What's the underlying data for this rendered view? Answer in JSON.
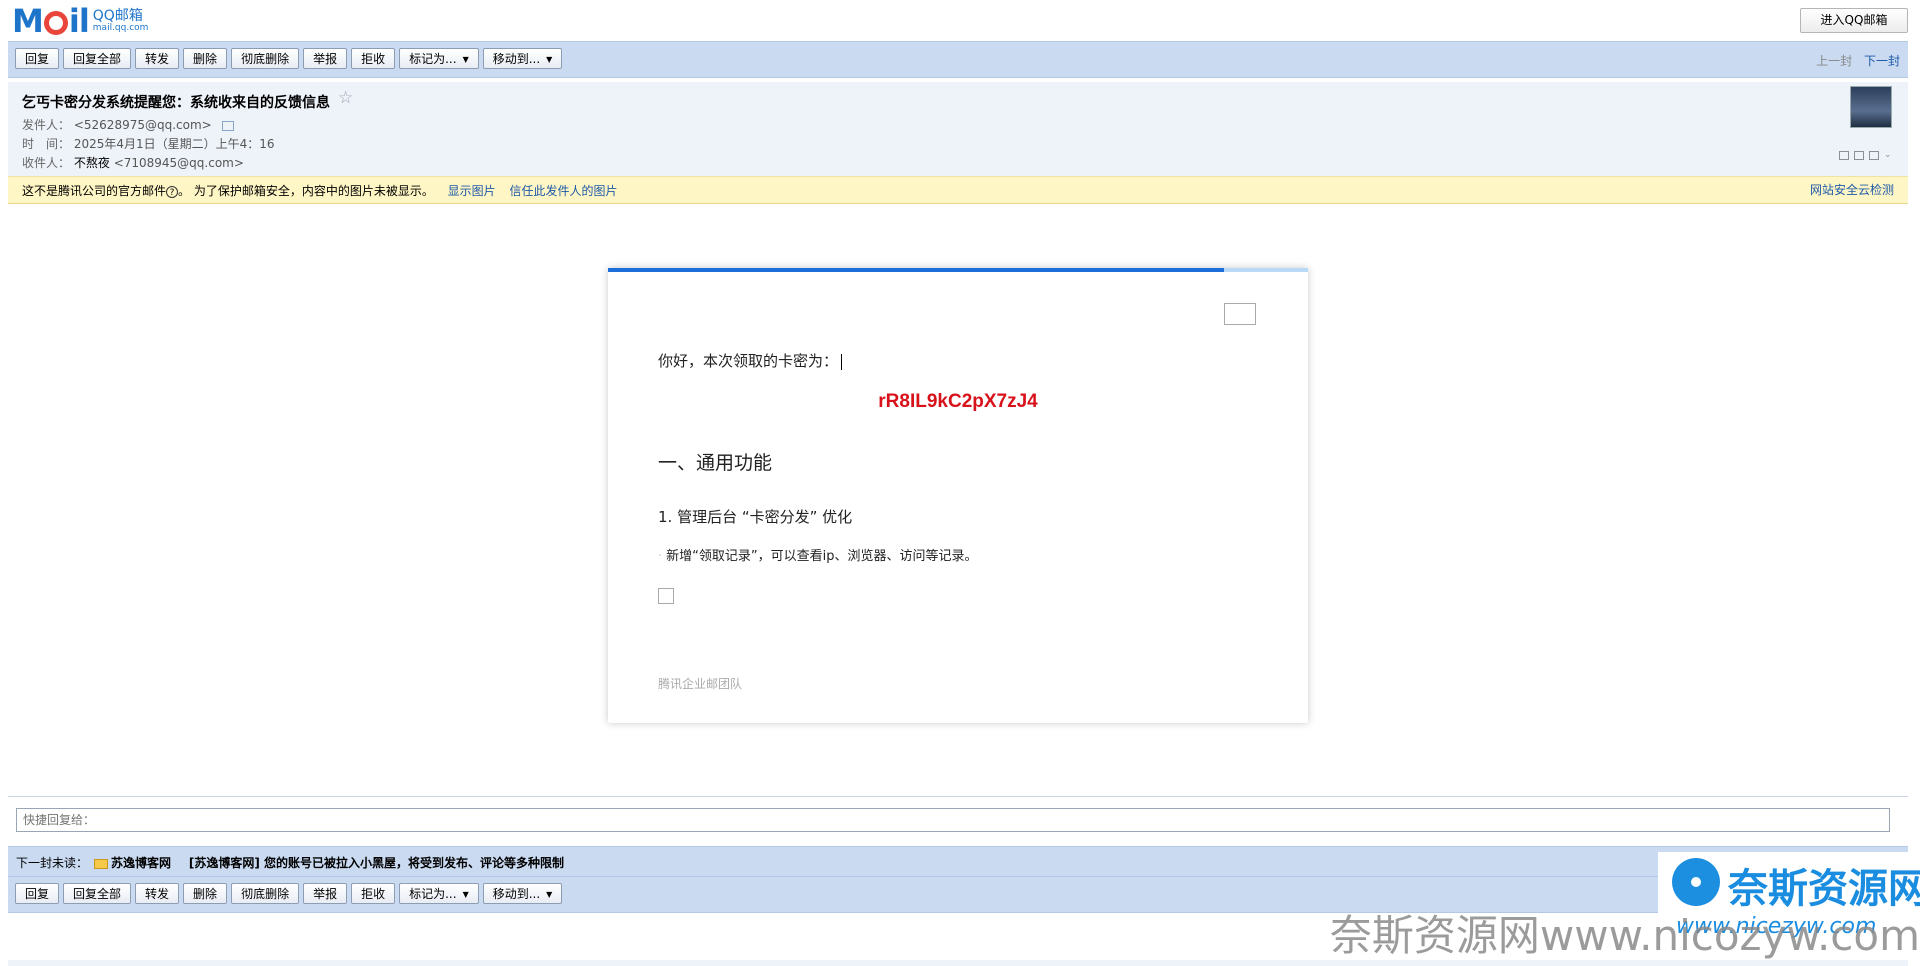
{
  "brand": {
    "logo_text": "Mail",
    "logo_sub1": "QQ邮箱",
    "logo_sub2": "mail.qq.com",
    "enter_label": "进入QQ邮箱",
    "colors": {
      "blue": "#1d74c9",
      "red": "#e9453a"
    }
  },
  "toolbar": {
    "reply": "回复",
    "reply_all": "回复全部",
    "forward": "转发",
    "delete": "删除",
    "delete_perm": "彻底删除",
    "report": "举报",
    "reject": "拒收",
    "mark_as": "标记为...",
    "move_to": "移动到...",
    "prev": "上一封",
    "next": "下一封"
  },
  "message": {
    "subject": "乞丐卡密分发系统提醒您：系统收来自的反馈信息",
    "from_label": "发件人：",
    "from_value": "<52628975@qq.com>",
    "time_label": "时　间：",
    "time_value": "2025年4月1日（星期二）上午4：16",
    "to_label": "收件人：",
    "to_name": "不熬夜",
    "to_email": "<7108945@qq.com>"
  },
  "warning": {
    "text1": "这不是腾讯公司的官方邮件",
    "help": "?",
    "text2": "。 为了保护邮箱安全，内容中的图片未被显示。",
    "show_images": "显示图片",
    "trust_sender": "信任此发件人的图片",
    "right_link": "网站安全云检测"
  },
  "body": {
    "progress": 0.88,
    "greeting": "你好，本次领取的卡密为：",
    "code": "rR8IL9kC2pX7zJ4",
    "heading": "一、通用功能",
    "subheading": "1. 管理后台 “卡密分发” 优化",
    "item": "新增“领取记录”，可以查看ip、浏览器、访问等记录。",
    "signature": "腾讯企业邮团队"
  },
  "quick_reply": {
    "placeholder": "快捷回复给："
  },
  "next_unread": {
    "label": "下一封未读：",
    "sender": "苏逸博客网",
    "subject": "[苏逸博客网] 您的账号已被拉入小黑屋，将受到发布、评论等多种限制"
  },
  "watermark": {
    "title": "奈斯资源网",
    "url": "www.nicezyw.com",
    "big": "奈斯资源网www.nicozyw.com"
  }
}
